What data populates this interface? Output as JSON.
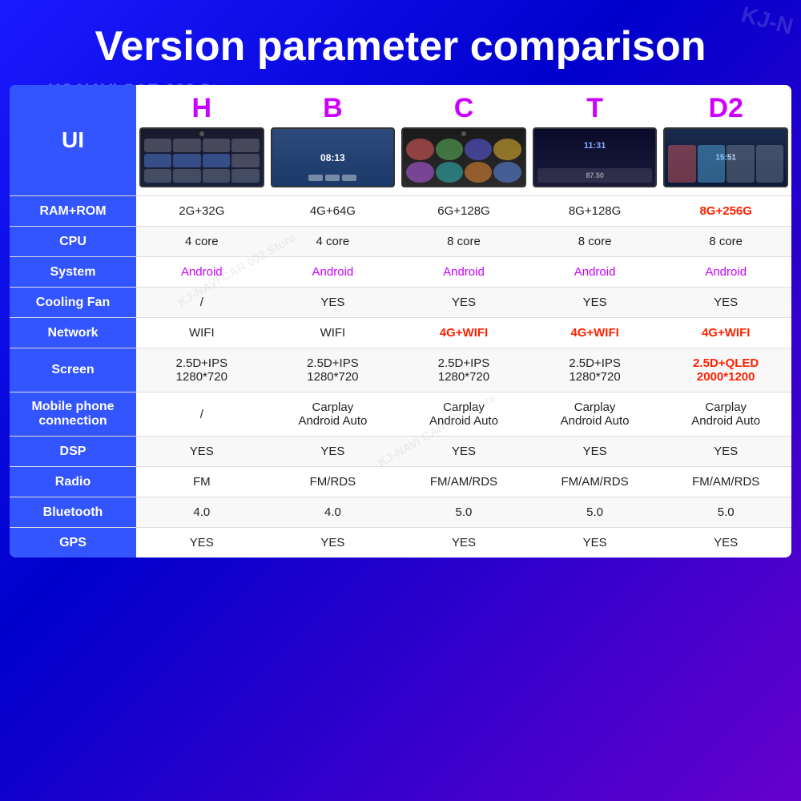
{
  "page": {
    "title": "Version parameter comparison",
    "store_watermark": "KJ-NAVI CAR 002 Store",
    "corner_watermark": "KJ-N"
  },
  "table": {
    "label_column": "label-col",
    "ui_row_label": "UI",
    "versions": [
      "H",
      "B",
      "C",
      "T",
      "D2"
    ],
    "rows": [
      {
        "label": "RAM+ROM",
        "values": [
          "2G+32G",
          "4G+64G",
          "6G+128G",
          "8G+128G",
          "8G+256G"
        ],
        "highlight_last": true
      },
      {
        "label": "CPU",
        "values": [
          "4 core",
          "4 core",
          "8 core",
          "8 core",
          "8 core"
        ]
      },
      {
        "label": "System",
        "values": [
          "Android",
          "Android",
          "Android",
          "Android",
          "Android"
        ],
        "android": true
      },
      {
        "label": "Cooling Fan",
        "values": [
          "/",
          "YES",
          "YES",
          "YES",
          "YES"
        ]
      },
      {
        "label": "Network",
        "values": [
          "WIFI",
          "WIFI",
          "4G+WIFI",
          "4G+WIFI",
          "4G+WIFI"
        ],
        "highlight_4g": true
      },
      {
        "label": "Screen",
        "values": [
          "2.5D+IPS\n1280*720",
          "2.5D+IPS\n1280*720",
          "2.5D+IPS\n1280*720",
          "2.5D+IPS\n1280*720",
          "2.5D+QLED\n2000*1200"
        ],
        "highlight_last": true
      },
      {
        "label": "Mobile phone\nconnection",
        "values": [
          "/",
          "Carplay\nAndroid Auto",
          "Carplay\nAndroid Auto",
          "Carplay\nAndroid Auto",
          "Carplay\nAndroid Auto"
        ]
      },
      {
        "label": "DSP",
        "values": [
          "YES",
          "YES",
          "YES",
          "YES",
          "YES"
        ]
      },
      {
        "label": "Radio",
        "values": [
          "FM",
          "FM/RDS",
          "FM/AM/RDS",
          "FM/AM/RDS",
          "FM/AM/RDS"
        ]
      },
      {
        "label": "Bluetooth",
        "values": [
          "4.0",
          "4.0",
          "5.0",
          "5.0",
          "5.0"
        ]
      },
      {
        "label": "GPS",
        "values": [
          "YES",
          "YES",
          "YES",
          "YES",
          "YES"
        ]
      }
    ]
  }
}
